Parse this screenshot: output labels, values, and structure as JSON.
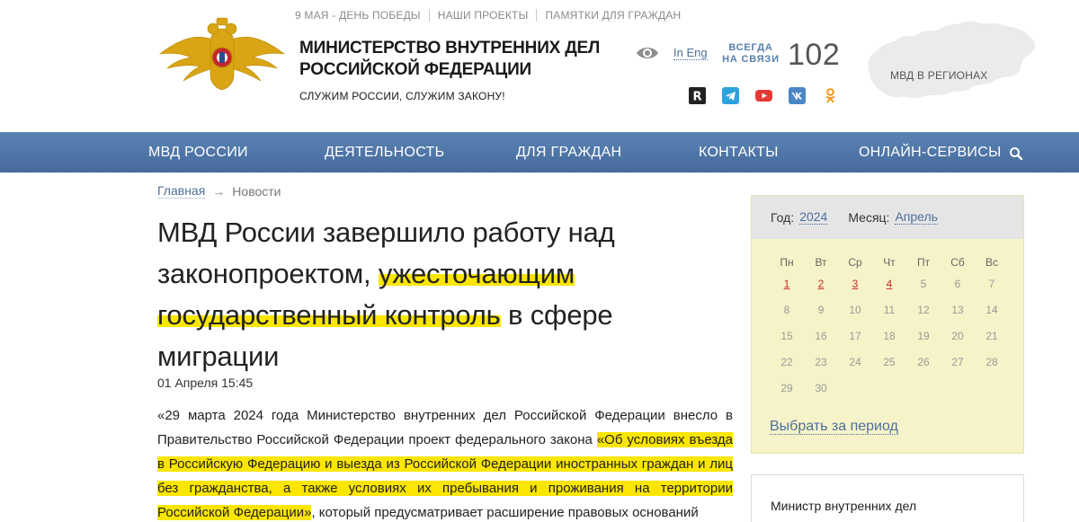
{
  "top_links": [
    "9 МАЯ - ДЕНЬ ПОБЕДЫ",
    "НАШИ ПРОЕКТЫ",
    "ПАМЯТКИ ДЛЯ ГРАЖДАН"
  ],
  "header": {
    "title_line1": "МИНИСТЕРСТВО ВНУТРЕННИХ ДЕЛ",
    "title_line2": "РОССИЙСКОЙ ФЕДЕРАЦИИ",
    "slogan": "СЛУЖИМ РОССИИ, СЛУЖИМ ЗАКОНУ!",
    "lang_link": "In Eng",
    "always_line1": "ВСЕГДА",
    "always_line2": "НА СВЯЗИ",
    "phone": "102",
    "regions_link": "МВД В РЕГИОНАХ"
  },
  "socials": [
    "rutube-icon",
    "telegram-icon",
    "youtube-icon",
    "vk-icon",
    "odnoklassniki-icon"
  ],
  "nav": [
    "МВД РОССИИ",
    "ДЕЯТЕЛЬНОСТЬ",
    "ДЛЯ ГРАЖДАН",
    "КОНТАКТЫ",
    "ОНЛАЙН-СЕРВИСЫ"
  ],
  "breadcrumb": {
    "home": "Главная",
    "current": "Новости"
  },
  "article": {
    "title_part1": "МВД России завершило работу над законопроектом, ",
    "title_hl1": "ужесточающим",
    "title_hl2": "государственный контроль",
    "title_part2": " в сфере миграции",
    "date": "01 Апреля 15:45",
    "body_part1": "«29 марта 2024 года Министерство внутренних дел Российской Федерации внесло в Правительство Российской Федерации проект федерального закона ",
    "body_hl": "«Об условиях въезда в Российскую Федерацию и выезда из Российской Федерации иностранных граждан и лиц без гражданства, а также условиях их пребывания и проживания на территории Российской Федерации»",
    "body_part2": ", который предусматривает расширение правовых оснований"
  },
  "calendar": {
    "year_label": "Год:",
    "year": "2024",
    "month_label": "Месяц:",
    "month": "Апрель",
    "weekdays": [
      "Пн",
      "Вт",
      "Ср",
      "Чт",
      "Пт",
      "Сб",
      "Вс"
    ],
    "weeks": [
      [
        "1",
        "2",
        "3",
        "4",
        "5",
        "6",
        "7"
      ],
      [
        "8",
        "9",
        "10",
        "11",
        "12",
        "13",
        "14"
      ],
      [
        "15",
        "16",
        "17",
        "18",
        "19",
        "20",
        "21"
      ],
      [
        "22",
        "23",
        "24",
        "25",
        "26",
        "27",
        "28"
      ],
      [
        "29",
        "30",
        "",
        "",
        "",
        "",
        ""
      ]
    ],
    "active_days": [
      "1",
      "2",
      "3",
      "4"
    ],
    "period_link": "Выбрать за период"
  },
  "minister_box": "Министр внутренних дел",
  "colors": {
    "nav": "#4f77a8",
    "link": "#4d6f9a",
    "highlight": "#fbe600",
    "calendar_bg": "#f6f3c9",
    "active_day": "#cc2b2b"
  }
}
